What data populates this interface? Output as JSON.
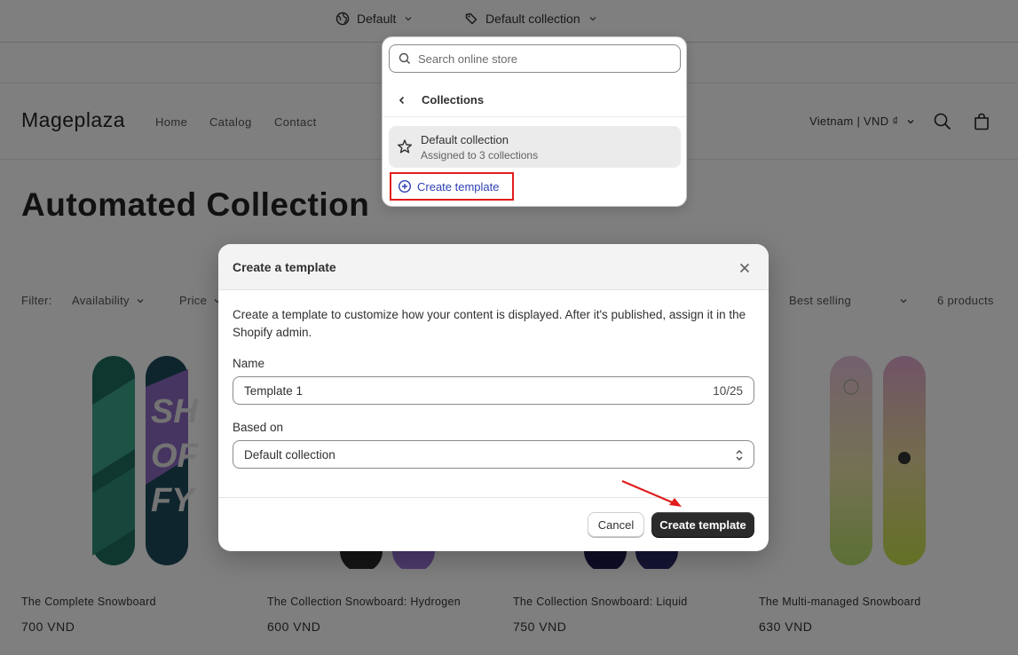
{
  "topbar": {
    "theme_selector": "Default",
    "template_selector": "Default collection"
  },
  "store": {
    "logo": "Mageplaza",
    "nav": [
      "Home",
      "Catalog",
      "Contact"
    ],
    "locale": "Vietnam | VND ₫",
    "collection_title": "Automated Collection",
    "filter_label": "Filter:",
    "filters": [
      "Availability",
      "Price"
    ],
    "sort_value": "Best selling",
    "product_count": "6 products",
    "products": [
      {
        "name": "The Complete Snowboard",
        "price": "700 VND"
      },
      {
        "name": "The Collection Snowboard: Hydrogen",
        "price": "600 VND"
      },
      {
        "name": "The Collection Snowboard: Liquid",
        "price": "750 VND"
      },
      {
        "name": "The Multi-managed Snowboard",
        "price": "630 VND"
      }
    ]
  },
  "popover": {
    "search_placeholder": "Search online store",
    "back_label": "Collections",
    "item_name": "Default collection",
    "item_sub": "Assigned to 3 collections",
    "create_label": "Create template"
  },
  "modal": {
    "title": "Create a template",
    "description": "Create a template to customize how your content is displayed. After it's published, assign it in the Shopify admin.",
    "name_label": "Name",
    "name_value": "Template 1",
    "name_count": "10/25",
    "based_on_label": "Based on",
    "based_on_value": "Default collection",
    "cancel_label": "Cancel",
    "create_label": "Create template"
  },
  "colors": {
    "highlight": "#e11d1d",
    "link": "#2c3fb5",
    "primary_button": "#2b2b2b"
  }
}
